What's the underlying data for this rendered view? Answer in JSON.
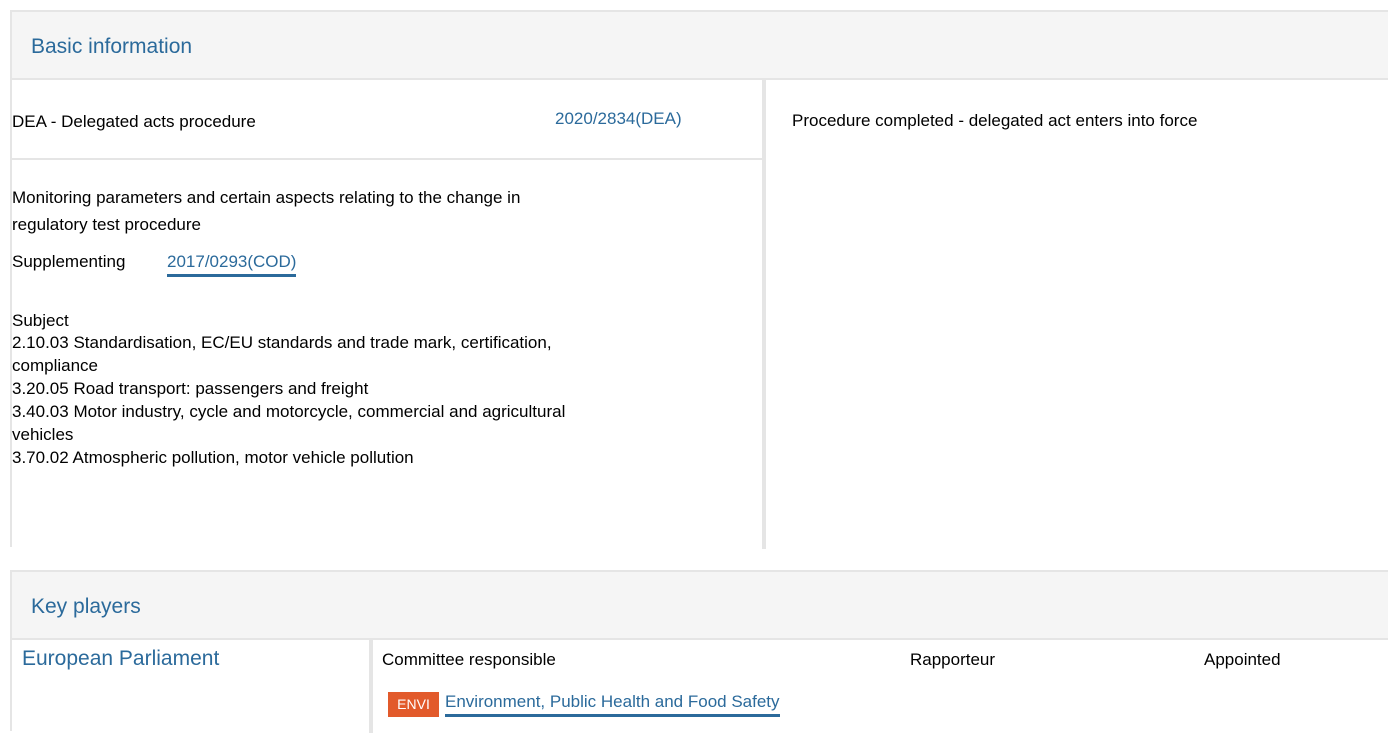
{
  "basic_information": {
    "title": "Basic information",
    "procedure_type": "DEA - Delegated acts procedure",
    "procedure_ref": "2020/2834(DEA)",
    "status": "Procedure completed - delegated act enters into force",
    "description_line1": "Monitoring parameters and certain aspects relating to the change in",
    "description_line2": "regulatory test procedure",
    "supplementing_label": "Supplementing",
    "supplementing_ref": "2017/0293(COD)",
    "subject_label": "Subject",
    "subjects": [
      "2.10.03 Standardisation, EC/EU standards and trade mark, certification,",
      "compliance",
      "3.20.05 Road transport: passengers and freight",
      "3.40.03 Motor industry, cycle and motorcycle, commercial and agricultural",
      "vehicles",
      "3.70.02 Atmospheric pollution, motor vehicle pollution"
    ]
  },
  "key_players": {
    "title": "Key players",
    "institution": "European Parliament",
    "col_committee": "Committee responsible",
    "col_rapporteur": "Rapporteur",
    "col_appointed": "Appointed",
    "committee_badge": "ENVI",
    "committee_name": "Environment, Public Health and Food Safety"
  },
  "colors": {
    "link": "#2b6a9b",
    "header_bg": "#f5f5f5",
    "border": "#e5e5e5",
    "badge_bg": "#e25a2b"
  }
}
